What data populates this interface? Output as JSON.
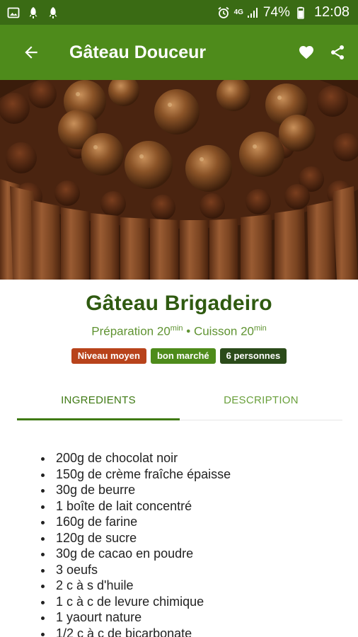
{
  "status_bar": {
    "network": "4G",
    "battery": "74%",
    "time": "12:08",
    "icons": [
      "image-icon",
      "rocket-icon",
      "rocket-icon",
      "alarm-icon",
      "signal-icon",
      "battery-icon"
    ]
  },
  "app_bar": {
    "title": "Gâteau Douceur",
    "icons": [
      "back-arrow-icon",
      "heart-icon",
      "share-icon"
    ]
  },
  "recipe": {
    "title": "Gâteau Brigadeiro",
    "prep_label": "Préparation",
    "prep_value": "20",
    "cook_label": "Cuisson",
    "cook_value": "20",
    "time_unit": "min",
    "separator": "•",
    "badges": {
      "level": "Niveau moyen",
      "price": "bon marché",
      "people": "6 personnes"
    }
  },
  "tabs": {
    "ingredients": "INGREDIENTS",
    "description": "DESCRIPTION",
    "active": "ingredients"
  },
  "ingredients": [
    "200g de chocolat noir",
    "150g de crème fraîche épaisse",
    "30g de beurre",
    "1 boîte de lait concentré",
    "160g de farine",
    "120g de sucre",
    "30g de cacao en poudre",
    "3 oeufs",
    "2 c à s d'huile",
    "1 c à c de levure chimique",
    "1 yaourt nature",
    "1/2 c à c de bicarbonate"
  ],
  "colors": {
    "status_bar": "#3a6b14",
    "app_bar": "#4e8b1b",
    "title_green": "#2f5a10",
    "badge_level": "#b8431b",
    "badge_price": "#4e8b1b",
    "badge_people": "#2b4b1a"
  }
}
